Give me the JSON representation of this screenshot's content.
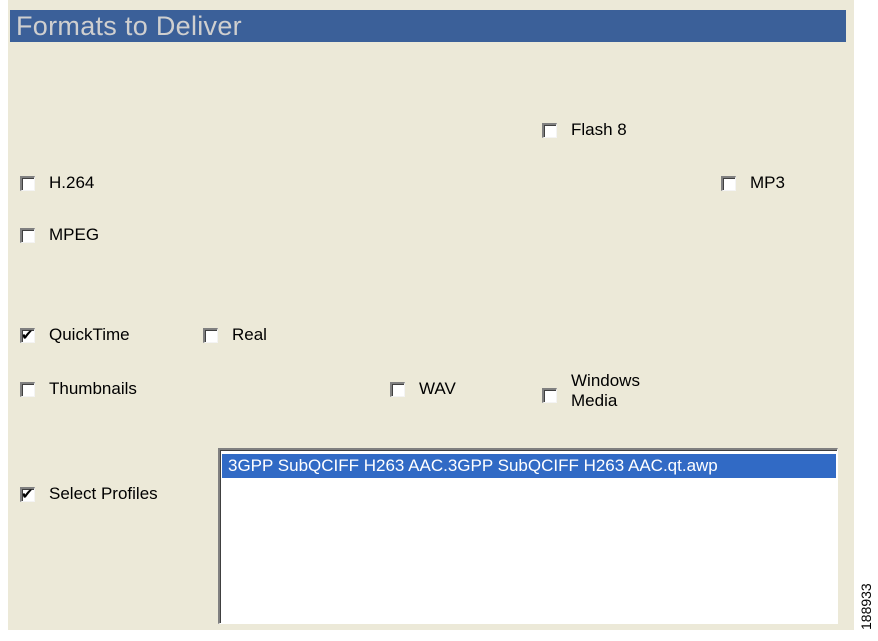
{
  "title": "Formats to Deliver",
  "checkboxes": {
    "flash8": {
      "label": "Flash 8",
      "checked": false
    },
    "h264": {
      "label": "H.264",
      "checked": false
    },
    "mp3": {
      "label": "MP3",
      "checked": false
    },
    "mpeg": {
      "label": "MPEG",
      "checked": false
    },
    "quicktime": {
      "label": "QuickTime",
      "checked": true
    },
    "real": {
      "label": "Real",
      "checked": false
    },
    "thumbnails": {
      "label": "Thumbnails",
      "checked": false
    },
    "wav": {
      "label": "WAV",
      "checked": false
    },
    "windows_media": {
      "label_line1": "Windows",
      "label_line2": "Media",
      "checked": false
    },
    "select_profiles": {
      "label": "Select Profiles",
      "checked": true
    }
  },
  "profiles_list": {
    "items": [
      "3GPP SubQCIFF H263 AAC.3GPP SubQCIFF H263 AAC.qt.awp"
    ],
    "selected_index": 0
  },
  "figure_number": "188933",
  "colors": {
    "panel_bg": "#ece9d8",
    "title_bar_bg": "#3b6099",
    "title_text": "#cfcfcf",
    "selection_bg": "#316ac5"
  },
  "tick_glyph": "✔"
}
